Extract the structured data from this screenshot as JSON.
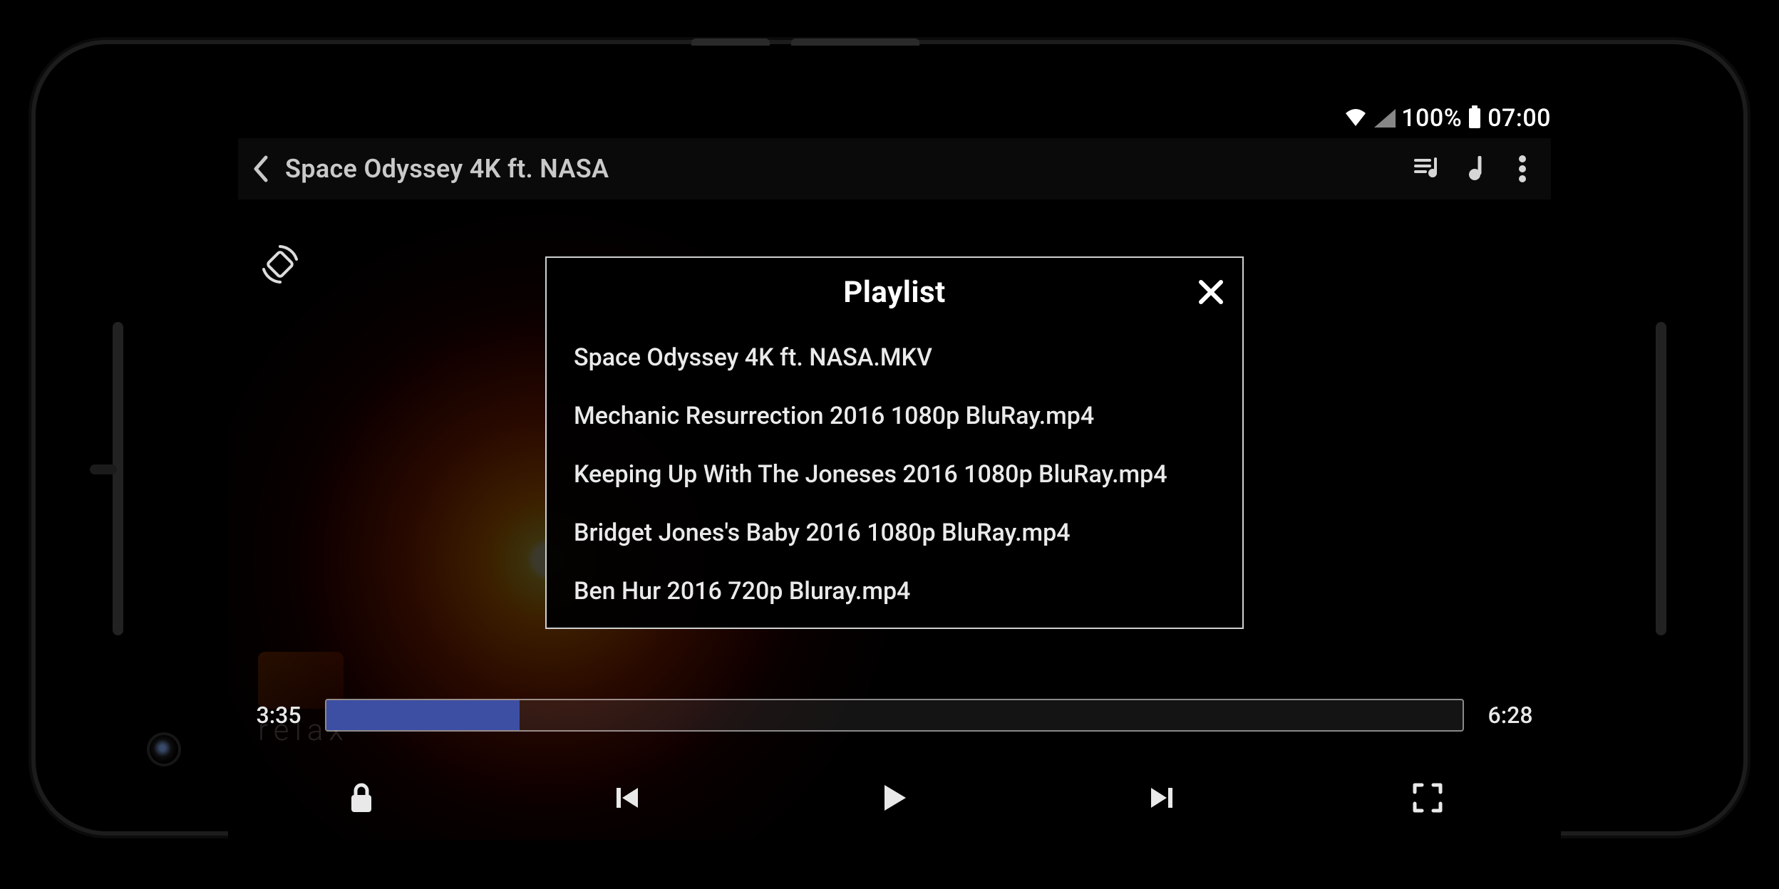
{
  "status": {
    "battery_percent": "100%",
    "clock": "07:00"
  },
  "player": {
    "title": "Space Odyssey 4K ft. NASA",
    "time_current": "3:35",
    "time_total": "6:28",
    "progress_percent": 17,
    "watermark_label": "relax"
  },
  "dialog": {
    "title": "Playlist",
    "items": [
      "Space Odyssey 4K ft. NASA.MKV",
      "Mechanic Resurrection 2016 1080p BluRay.mp4",
      "Keeping Up With The Joneses 2016 1080p BluRay.mp4",
      "Bridget Jones's Baby 2016 1080p BluRay.mp4",
      "Ben Hur 2016 720p Bluray.mp4"
    ]
  }
}
